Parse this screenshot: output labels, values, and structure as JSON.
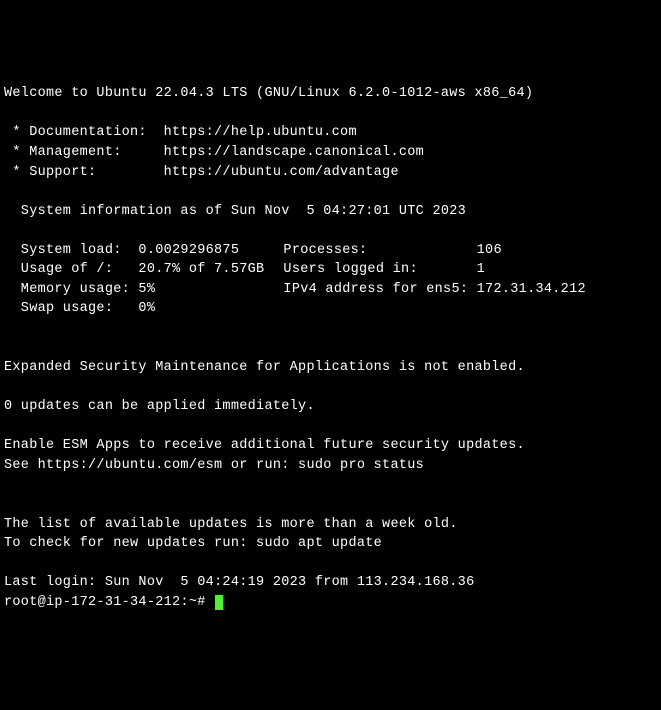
{
  "welcome": "Welcome to Ubuntu 22.04.3 LTS (GNU/Linux 6.2.0-1012-aws x86_64)",
  "links": {
    "doc_label": " * Documentation:  ",
    "doc_url": "https://help.ubuntu.com",
    "mgmt_label": " * Management:     ",
    "mgmt_url": "https://landscape.canonical.com",
    "supp_label": " * Support:        ",
    "supp_url": "https://ubuntu.com/advantage"
  },
  "sysinfo_header": "  System information as of Sun Nov  5 04:27:01 UTC 2023",
  "stats": {
    "row1_l_label": "  System load:  ",
    "row1_l_value": "0.0029296875",
    "row1_r_label": "Processes:             ",
    "row1_r_value": "106",
    "row2_l_label": "  Usage of /:   ",
    "row2_l_value": "20.7% of 7.57GB",
    "row2_r_label": "Users logged in:       ",
    "row2_r_value": "1",
    "row3_l_label": "  Memory usage: ",
    "row3_l_value": "5%",
    "row3_r_label": "IPv4 address for ens5: ",
    "row3_r_value": "172.31.34.212",
    "row4_l_label": "  Swap usage:   ",
    "row4_l_value": "0%"
  },
  "esm_notice": "Expanded Security Maintenance for Applications is not enabled.",
  "updates_notice": "0 updates can be applied immediately.",
  "esm_enable_line1": "Enable ESM Apps to receive additional future security updates.",
  "esm_enable_line2": "See https://ubuntu.com/esm or run: sudo pro status",
  "stale_line1": "The list of available updates is more than a week old.",
  "stale_line2": "To check for new updates run: sudo apt update",
  "last_login": "Last login: Sun Nov  5 04:24:19 2023 from 113.234.168.36",
  "prompt": "root@ip-172-31-34-212:~# "
}
